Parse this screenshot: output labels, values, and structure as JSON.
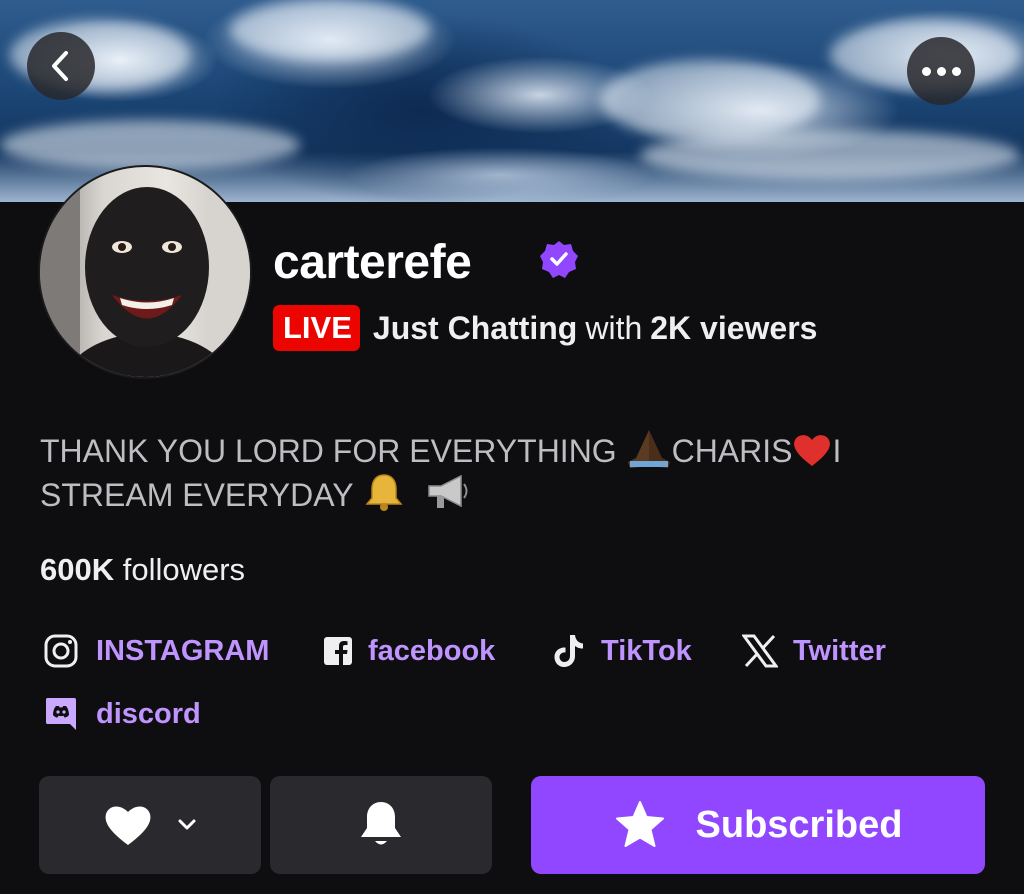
{
  "profile": {
    "username": "carterefe",
    "live_badge": "LIVE",
    "category": "Just Chatting",
    "with_text": "with",
    "viewers": "2K viewers",
    "bio_line1_a": "THANK YOU LORD FOR EVERYTHING ",
    "bio_line1_b": "CHARIS",
    "bio_line1_c": "I",
    "bio_line2": "STREAM EVERYDAY ",
    "followers_count": "600K",
    "followers_label": "followers"
  },
  "socials": [
    {
      "label": "INSTAGRAM",
      "icon": "instagram-icon"
    },
    {
      "label": "facebook",
      "icon": "facebook-icon"
    },
    {
      "label": "TikTok",
      "icon": "tiktok-icon"
    },
    {
      "label": "Twitter",
      "icon": "x-twitter-icon"
    },
    {
      "label": "discord",
      "icon": "discord-icon"
    }
  ],
  "actions": {
    "subscribe_label": "Subscribed"
  },
  "colors": {
    "accent": "#9147ff",
    "link": "#bf94ff",
    "live": "#eb0400",
    "background": "#0e0e10"
  }
}
